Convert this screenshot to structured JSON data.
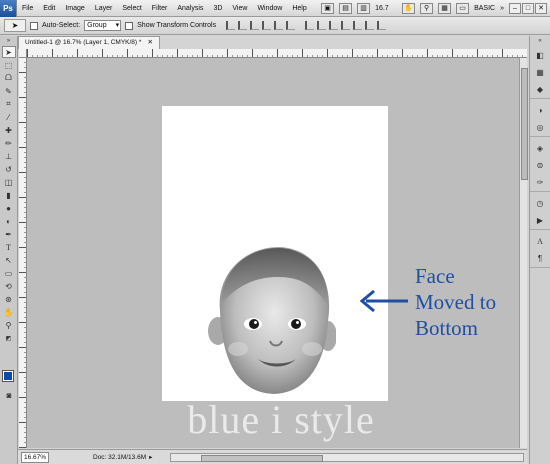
{
  "menubar": {
    "logo": "Ps",
    "items": [
      "File",
      "Edit",
      "Image",
      "Layer",
      "Select",
      "Filter",
      "Analysis",
      "3D",
      "View",
      "Window",
      "Help"
    ],
    "zoom": "16.7",
    "workspace": "BASIC"
  },
  "options": {
    "auto_select_label": "Auto-Select:",
    "auto_select_value": "Group",
    "transform_label": "Show Transform Controls"
  },
  "document": {
    "tab_title": "Untitled-1 @ 16.7% (Layer 1, CMYK/8) *"
  },
  "canvas": {
    "annotation_lines": [
      "Face",
      "Moved to",
      "Bottom"
    ],
    "watermark": "blue i style"
  },
  "status": {
    "zoom": "16.67%",
    "doc_info": "Doc: 32.1M/13.6M"
  },
  "colors": {
    "accent": "#1e4fa0",
    "foreground_swatch": "#0b4aa8",
    "canvas_bg": "#bdbdbd"
  },
  "icons": {
    "tools": [
      "move-icon",
      "marquee-icon",
      "lasso-icon",
      "quick-select-icon",
      "crop-icon",
      "eyedropper-icon",
      "healing-icon",
      "brush-icon",
      "stamp-icon",
      "history-brush-icon",
      "eraser-icon",
      "gradient-icon",
      "blur-icon",
      "dodge-icon",
      "pen-icon",
      "type-icon",
      "path-select-icon",
      "shape-icon",
      "3d-rotate-icon",
      "3d-orbit-icon",
      "hand-icon",
      "zoom-icon"
    ],
    "panels": [
      "color-icon",
      "swatches-icon",
      "styles-icon",
      "adjustments-icon",
      "masks-icon",
      "layers-icon",
      "channels-icon",
      "paths-icon",
      "history-icon",
      "actions-icon",
      "character-icon",
      "paragraph-icon"
    ]
  }
}
